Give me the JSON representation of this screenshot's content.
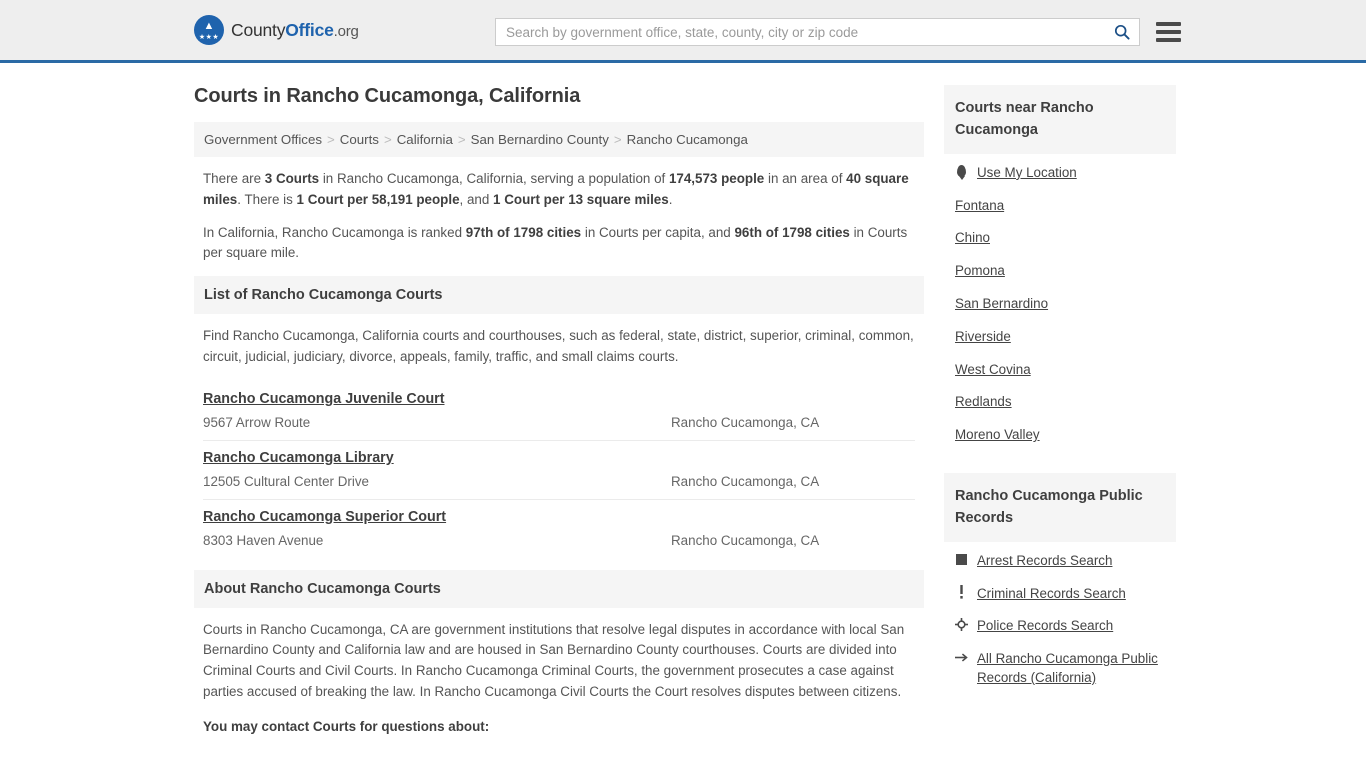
{
  "header": {
    "logo": {
      "county": "County",
      "office": "Office",
      "org": ".org",
      "mark_icon": "eagle-seal-icon"
    },
    "search": {
      "placeholder": "Search by government office, state, county, city or zip code",
      "value": "",
      "icon": "search-icon"
    },
    "menu_icon": "hamburger-menu-icon"
  },
  "page_title": "Courts in Rancho Cucamonga, California",
  "breadcrumb": {
    "separator": ">",
    "items": [
      "Government Offices",
      "Courts",
      "California",
      "San Bernardino County",
      "Rancho Cucamonga"
    ]
  },
  "intro": {
    "p1_parts": [
      {
        "t": "There are ",
        "b": false
      },
      {
        "t": "3 Courts",
        "b": true
      },
      {
        "t": " in Rancho Cucamonga, California, serving a population of ",
        "b": false
      },
      {
        "t": "174,573 people",
        "b": true
      },
      {
        "t": " in an area of ",
        "b": false
      },
      {
        "t": "40 square miles",
        "b": true
      },
      {
        "t": ". There is ",
        "b": false
      },
      {
        "t": "1 Court per 58,191 people",
        "b": true
      },
      {
        "t": ", and ",
        "b": false
      },
      {
        "t": "1 Court per 13 square miles",
        "b": true
      },
      {
        "t": ".",
        "b": false
      }
    ],
    "p2_parts": [
      {
        "t": "In California, Rancho Cucamonga is ranked ",
        "b": false
      },
      {
        "t": "97th of 1798 cities",
        "b": true
      },
      {
        "t": " in Courts per capita, and ",
        "b": false
      },
      {
        "t": "96th of 1798 cities",
        "b": true
      },
      {
        "t": " in Courts per square mile.",
        "b": false
      }
    ]
  },
  "list_section": {
    "heading": "List of Rancho Cucamonga Courts",
    "description": "Find Rancho Cucamonga, California courts and courthouses, such as federal, state, district, superior, criminal, common, circuit, judicial, judiciary, divorce, appeals, family, traffic, and small claims courts.",
    "courts": [
      {
        "name": "Rancho Cucamonga Juvenile Court",
        "address": "9567 Arrow Route",
        "city": "Rancho Cucamonga, CA"
      },
      {
        "name": "Rancho Cucamonga Library",
        "address": "12505 Cultural Center Drive",
        "city": "Rancho Cucamonga, CA"
      },
      {
        "name": "Rancho Cucamonga Superior Court",
        "address": "8303 Haven Avenue",
        "city": "Rancho Cucamonga, CA"
      }
    ]
  },
  "about_section": {
    "heading": "About Rancho Cucamonga Courts",
    "paragraph": "Courts in Rancho Cucamonga, CA are government institutions that resolve legal disputes in accordance with local San Bernardino County and California law and are housed in San Bernardino County courthouses. Courts are divided into Criminal Courts and Civil Courts. In Rancho Cucamonga Criminal Courts, the government prosecutes a case against parties accused of breaking the law. In Rancho Cucamonga Civil Courts the Court resolves disputes between citizens.",
    "next_paragraph_clipped": "You may contact Courts for questions about:"
  },
  "sidebar": {
    "nearby": {
      "heading": "Courts near Rancho Cucamonga",
      "items": [
        {
          "label": "Use My Location",
          "icon": "map-pin-icon"
        },
        {
          "label": "Fontana",
          "icon": ""
        },
        {
          "label": "Chino",
          "icon": ""
        },
        {
          "label": "Pomona",
          "icon": ""
        },
        {
          "label": "San Bernardino",
          "icon": ""
        },
        {
          "label": "Riverside",
          "icon": ""
        },
        {
          "label": "West Covina",
          "icon": ""
        },
        {
          "label": "Redlands",
          "icon": ""
        },
        {
          "label": "Moreno Valley",
          "icon": ""
        }
      ]
    },
    "public_records": {
      "heading": "Rancho Cucamonga Public Records",
      "items": [
        {
          "label": "Arrest Records Search",
          "icon": "square-icon"
        },
        {
          "label": "Criminal Records Search",
          "icon": "exclamation-icon"
        },
        {
          "label": "Police Records Search",
          "icon": "crosshair-icon"
        },
        {
          "label": "All Rancho Cucamonga Public Records (California)",
          "icon": "arrow-right-icon"
        }
      ]
    }
  },
  "colors": {
    "brand_blue": "#1f63ad",
    "header_bg": "#eeeeee",
    "header_border": "#2a6aa5",
    "panel_bg": "#f5f5f5",
    "body_text": "#555555"
  }
}
